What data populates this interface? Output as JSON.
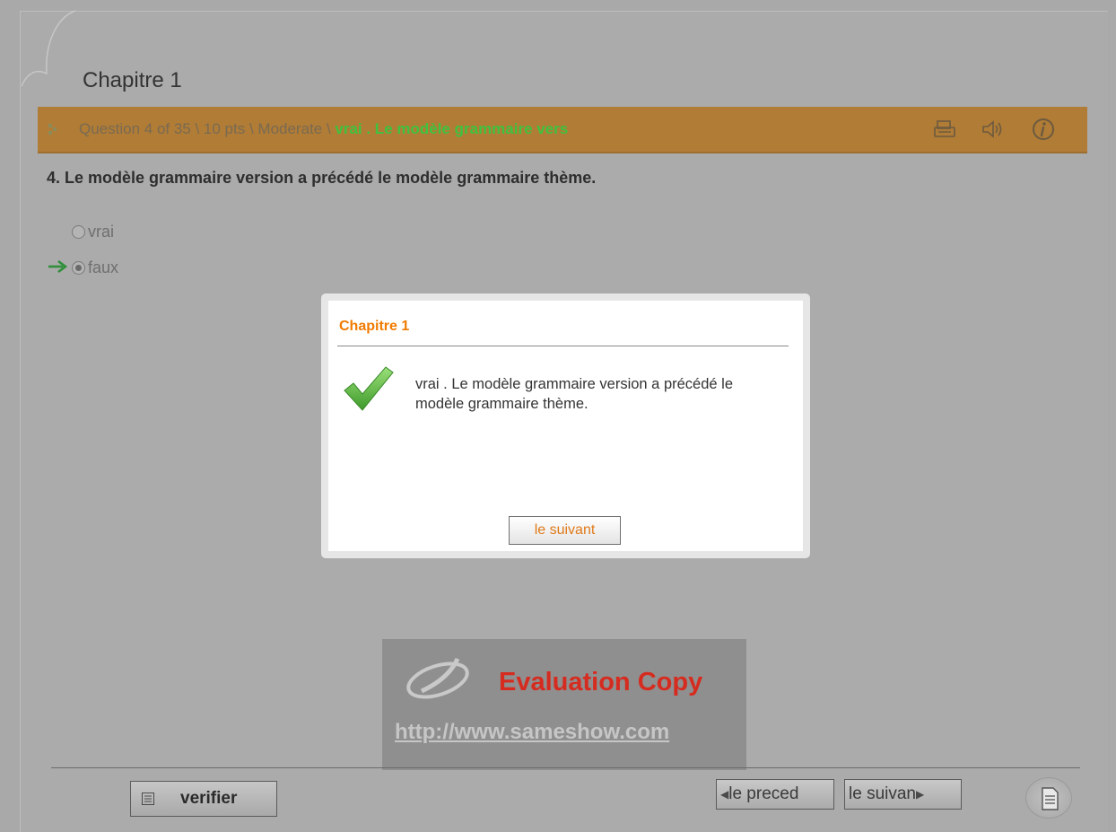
{
  "chapter": {
    "title": "Chapitre 1"
  },
  "question_bar": {
    "info": "Question 4 of 35 \\ 10 pts \\ Moderate \\ ",
    "feedback": "vrai . Le modèle grammaire vers",
    "icons": [
      "print-icon",
      "speaker-icon",
      "info-icon"
    ]
  },
  "question": {
    "text": "4.  Le modèle grammaire version a précédé le modèle grammaire thème.",
    "options": [
      {
        "label": "vrai",
        "selected": false
      },
      {
        "label": "faux",
        "selected": true
      }
    ]
  },
  "dialog": {
    "title": "Chapitre 1",
    "message": "vrai . Le modèle grammaire version a précédé le modèle grammaire thème.",
    "button": "le suivant",
    "icon": "checkmark-icon"
  },
  "watermark": {
    "title": "Evaluation Copy",
    "url": "http://www.sameshow.com"
  },
  "footer": {
    "verify": "verifier",
    "prev": "le preced",
    "next": "le suivan",
    "doc_icon": "document-icon"
  },
  "colors": {
    "accent_bar": "#b07c36",
    "feedback_green": "#3fc23f",
    "dialog_title": "#f07b00",
    "watermark_red": "#d62b1f"
  }
}
